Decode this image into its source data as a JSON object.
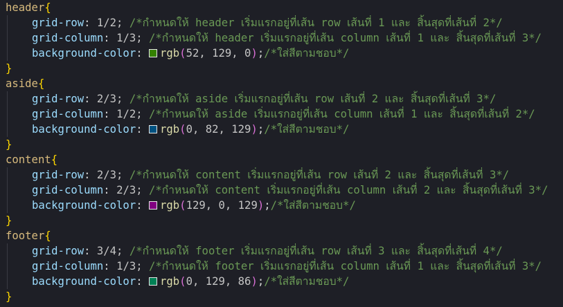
{
  "code": {
    "blocks": [
      {
        "selector": "header",
        "open": "{",
        "close": "}",
        "grid_row_prop": "grid-row",
        "grid_row_value": "1/2;",
        "grid_row_comment": "/*กำหนดให้ header เริ่มแรกอยู่ที่เส้น row เส้นที่ 1 และ สิ้นสุดที่เส้นที่ 2*/",
        "grid_col_prop": "grid-column",
        "grid_col_value": "1/3;",
        "grid_col_comment": "/*กำหนดให้ header เริ่มแรกอยู่ที่เส้น column เส้นที่ 1 และ สิ้นสุดที่เส้นที่ 3*/",
        "bg_prop": "background-color",
        "swatch_color": "#348100",
        "rgb_fn": "rgb",
        "rgb_args": "52, 129, 0",
        "bg_tail": ";",
        "bg_comment": "/*ใส่สีตามชอบ*/"
      },
      {
        "selector": "aside",
        "open": "{",
        "close": "}",
        "grid_row_prop": "grid-row",
        "grid_row_value": "2/3;",
        "grid_row_comment": "/*กำหนดให้ aside เริ่มแรกอยู่ที่เส้น row เส้นที่ 2 และ สิ้นสุดที่เส้นที่ 3*/",
        "grid_col_prop": "grid-column",
        "grid_col_value": "1/2;",
        "grid_col_comment": "/*กำหนดให้ aside เริ่มแรกอยู่ที่เส้น column เส้นที่ 1 และ สิ้นสุดที่เส้นที่ 2*/",
        "bg_prop": "background-color",
        "swatch_color": "#005281",
        "rgb_fn": "rgb",
        "rgb_args": "0, 82, 129",
        "bg_tail": ";",
        "bg_comment": "/*ใส่สีตามชอบ*/"
      },
      {
        "selector": "content",
        "open": "{",
        "close": "}",
        "grid_row_prop": "grid-row",
        "grid_row_value": "2/3;",
        "grid_row_comment": "/*กำหนดให้ content เริ่มแรกอยู่ที่เส้น row เส้นที่ 2 และ สิ้นสุดที่เส้นที่ 3*/",
        "grid_col_prop": "grid-column",
        "grid_col_value": "2/3;",
        "grid_col_comment": "/*กำหนดให้ content เริ่มแรกอยู่ที่เส้น column เส้นที่ 2 และ สิ้นสุดที่เส้นที่ 3*/",
        "bg_prop": "background-color",
        "swatch_color": "#810081",
        "rgb_fn": "rgb",
        "rgb_args": "129, 0, 129",
        "bg_tail": ";",
        "bg_comment": "/*ใส่สีตามชอบ*/"
      },
      {
        "selector": "footer",
        "open": "{",
        "close": "}",
        "grid_row_prop": "grid-row",
        "grid_row_value": "3/4;",
        "grid_row_comment": "/*กำหนดให้ footer เริ่มแรกอยู่ที่เส้น row เส้นที่ 3 และ สิ้นสุดที่เส้นที่ 4*/",
        "grid_col_prop": "grid-column",
        "grid_col_value": "1/3;",
        "grid_col_comment": "/*กำหนดให้ footer เริ่มแรกอยู่ที่เส้น column เส้นที่ 1 และ สิ้นสุดที่เส้นที่ 3*/",
        "bg_prop": "background-color",
        "swatch_color": "#008156",
        "rgb_fn": "rgb",
        "rgb_args": "0, 129, 86",
        "bg_tail": ";",
        "bg_comment": "/*ใส่สีตามชอบ*/"
      }
    ]
  }
}
